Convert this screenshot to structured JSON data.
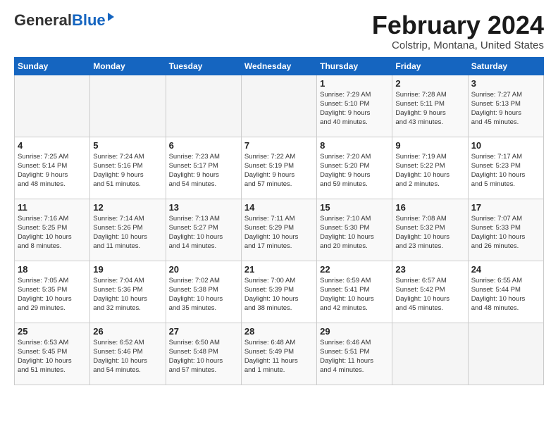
{
  "header": {
    "logo_general": "General",
    "logo_blue": "Blue",
    "month_title": "February 2024",
    "location": "Colstrip, Montana, United States"
  },
  "weekdays": [
    "Sunday",
    "Monday",
    "Tuesday",
    "Wednesday",
    "Thursday",
    "Friday",
    "Saturday"
  ],
  "weeks": [
    [
      {
        "day": "",
        "info": ""
      },
      {
        "day": "",
        "info": ""
      },
      {
        "day": "",
        "info": ""
      },
      {
        "day": "",
        "info": ""
      },
      {
        "day": "1",
        "info": "Sunrise: 7:29 AM\nSunset: 5:10 PM\nDaylight: 9 hours\nand 40 minutes."
      },
      {
        "day": "2",
        "info": "Sunrise: 7:28 AM\nSunset: 5:11 PM\nDaylight: 9 hours\nand 43 minutes."
      },
      {
        "day": "3",
        "info": "Sunrise: 7:27 AM\nSunset: 5:13 PM\nDaylight: 9 hours\nand 45 minutes."
      }
    ],
    [
      {
        "day": "4",
        "info": "Sunrise: 7:25 AM\nSunset: 5:14 PM\nDaylight: 9 hours\nand 48 minutes."
      },
      {
        "day": "5",
        "info": "Sunrise: 7:24 AM\nSunset: 5:16 PM\nDaylight: 9 hours\nand 51 minutes."
      },
      {
        "day": "6",
        "info": "Sunrise: 7:23 AM\nSunset: 5:17 PM\nDaylight: 9 hours\nand 54 minutes."
      },
      {
        "day": "7",
        "info": "Sunrise: 7:22 AM\nSunset: 5:19 PM\nDaylight: 9 hours\nand 57 minutes."
      },
      {
        "day": "8",
        "info": "Sunrise: 7:20 AM\nSunset: 5:20 PM\nDaylight: 9 hours\nand 59 minutes."
      },
      {
        "day": "9",
        "info": "Sunrise: 7:19 AM\nSunset: 5:22 PM\nDaylight: 10 hours\nand 2 minutes."
      },
      {
        "day": "10",
        "info": "Sunrise: 7:17 AM\nSunset: 5:23 PM\nDaylight: 10 hours\nand 5 minutes."
      }
    ],
    [
      {
        "day": "11",
        "info": "Sunrise: 7:16 AM\nSunset: 5:25 PM\nDaylight: 10 hours\nand 8 minutes."
      },
      {
        "day": "12",
        "info": "Sunrise: 7:14 AM\nSunset: 5:26 PM\nDaylight: 10 hours\nand 11 minutes."
      },
      {
        "day": "13",
        "info": "Sunrise: 7:13 AM\nSunset: 5:27 PM\nDaylight: 10 hours\nand 14 minutes."
      },
      {
        "day": "14",
        "info": "Sunrise: 7:11 AM\nSunset: 5:29 PM\nDaylight: 10 hours\nand 17 minutes."
      },
      {
        "day": "15",
        "info": "Sunrise: 7:10 AM\nSunset: 5:30 PM\nDaylight: 10 hours\nand 20 minutes."
      },
      {
        "day": "16",
        "info": "Sunrise: 7:08 AM\nSunset: 5:32 PM\nDaylight: 10 hours\nand 23 minutes."
      },
      {
        "day": "17",
        "info": "Sunrise: 7:07 AM\nSunset: 5:33 PM\nDaylight: 10 hours\nand 26 minutes."
      }
    ],
    [
      {
        "day": "18",
        "info": "Sunrise: 7:05 AM\nSunset: 5:35 PM\nDaylight: 10 hours\nand 29 minutes."
      },
      {
        "day": "19",
        "info": "Sunrise: 7:04 AM\nSunset: 5:36 PM\nDaylight: 10 hours\nand 32 minutes."
      },
      {
        "day": "20",
        "info": "Sunrise: 7:02 AM\nSunset: 5:38 PM\nDaylight: 10 hours\nand 35 minutes."
      },
      {
        "day": "21",
        "info": "Sunrise: 7:00 AM\nSunset: 5:39 PM\nDaylight: 10 hours\nand 38 minutes."
      },
      {
        "day": "22",
        "info": "Sunrise: 6:59 AM\nSunset: 5:41 PM\nDaylight: 10 hours\nand 42 minutes."
      },
      {
        "day": "23",
        "info": "Sunrise: 6:57 AM\nSunset: 5:42 PM\nDaylight: 10 hours\nand 45 minutes."
      },
      {
        "day": "24",
        "info": "Sunrise: 6:55 AM\nSunset: 5:44 PM\nDaylight: 10 hours\nand 48 minutes."
      }
    ],
    [
      {
        "day": "25",
        "info": "Sunrise: 6:53 AM\nSunset: 5:45 PM\nDaylight: 10 hours\nand 51 minutes."
      },
      {
        "day": "26",
        "info": "Sunrise: 6:52 AM\nSunset: 5:46 PM\nDaylight: 10 hours\nand 54 minutes."
      },
      {
        "day": "27",
        "info": "Sunrise: 6:50 AM\nSunset: 5:48 PM\nDaylight: 10 hours\nand 57 minutes."
      },
      {
        "day": "28",
        "info": "Sunrise: 6:48 AM\nSunset: 5:49 PM\nDaylight: 11 hours\nand 1 minute."
      },
      {
        "day": "29",
        "info": "Sunrise: 6:46 AM\nSunset: 5:51 PM\nDaylight: 11 hours\nand 4 minutes."
      },
      {
        "day": "",
        "info": ""
      },
      {
        "day": "",
        "info": ""
      }
    ]
  ]
}
